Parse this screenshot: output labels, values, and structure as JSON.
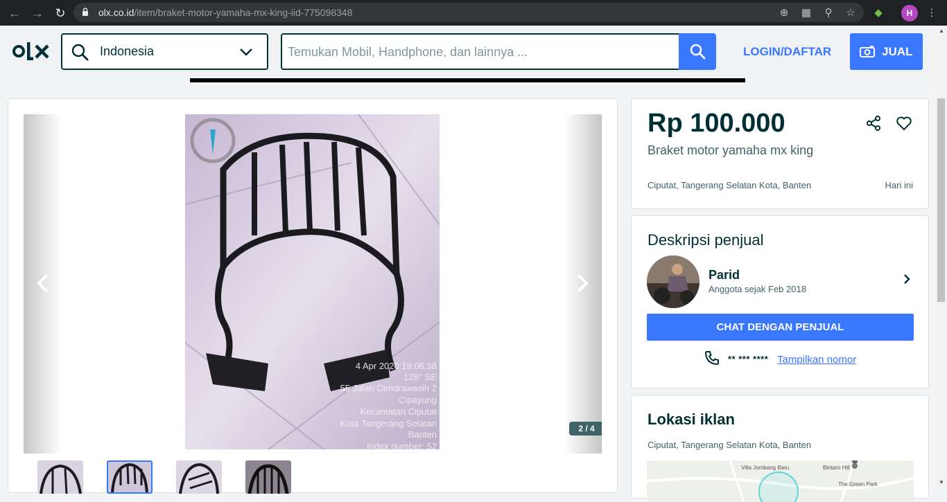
{
  "browser": {
    "url_host": "olx.co.id",
    "url_path": "/item/braket-motor-yamaha-mx-king-iid-775098348",
    "profile_initial": "H"
  },
  "header": {
    "location_value": "Indonesia",
    "search_placeholder": "Temukan Mobil, Handphone, dan lainnya ...",
    "login_label": "LOGIN/DAFTAR",
    "sell_label": "JUAL"
  },
  "gallery": {
    "counter": "2 / 4",
    "photo_overlay": [
      "4 Apr 2020 19:06:38",
      "128° SE",
      "55 Jalan Cendrawasih 2",
      "Cipayung",
      "Kecamatan Ciputat",
      "Kota Tangerang Selatan",
      "Banten",
      "Index number: 52"
    ],
    "thumbnail_count": 4,
    "active_thumbnail": 2
  },
  "listing": {
    "price": "Rp 100.000",
    "title": "Braket motor yamaha mx king",
    "location": "Ciputat, Tangerang Selatan Kota, Banten",
    "date": "Hari ini"
  },
  "seller": {
    "section_title": "Deskripsi penjual",
    "name": "Parid",
    "member_since": "Anggota sejak Feb 2018",
    "chat_label": "CHAT DENGAN PENJUAL",
    "phone_masked": "** *** ****",
    "show_number_label": "Tampilkan nomor"
  },
  "location_section": {
    "title": "Lokasi iklan",
    "location": "Ciputat, Tangerang Selatan Kota, Banten",
    "map_labels": [
      "Villa Jombang Baru",
      "Bintaro Hill",
      "The Green Park"
    ]
  },
  "colors": {
    "brand_dark": "#002f34",
    "accent_blue": "#3a77ff",
    "muted_text": "#406367"
  }
}
